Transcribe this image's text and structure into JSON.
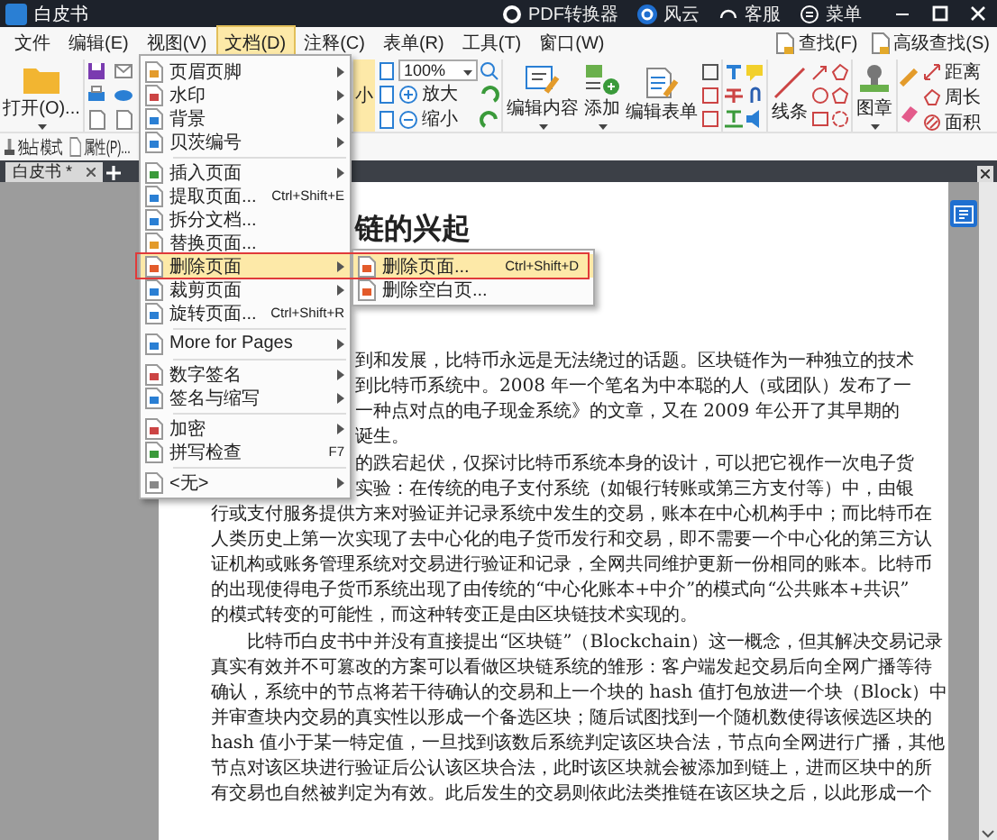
{
  "window": {
    "title": "白皮书"
  },
  "title_bar": [
    {
      "label": "PDF转换器"
    },
    {
      "label": "风云"
    },
    {
      "label": "客服"
    },
    {
      "label": "菜单"
    }
  ],
  "menu_bar": [
    {
      "label": "文件",
      "selected": false
    },
    {
      "label": "编辑(E)",
      "selected": false
    },
    {
      "label": "视图(V)",
      "selected": false
    },
    {
      "label": "文档(D)",
      "selected": true
    },
    {
      "label": "注释(C)",
      "selected": false
    },
    {
      "label": "表单(R)",
      "selected": false
    },
    {
      "label": "工具(T)",
      "selected": false
    },
    {
      "label": "窗口(W)",
      "selected": false
    }
  ],
  "search_buttons": [
    "查找(F)",
    "高级查找(S)"
  ],
  "ribbon": {
    "open": "打开(O)...",
    "partial_label": "小",
    "zoom": "100%",
    "zoom_in": "放大",
    "zoom_out": "缩小",
    "edit_content": "编辑内容",
    "add": "添加",
    "edit_form": "编辑表单",
    "line": "线条",
    "stamp": "图章",
    "distance": "距离",
    "perimeter": "周长",
    "area": "面积",
    "exclusive_mode": "独占模式",
    "properties": "属性(P)..."
  },
  "tabs": [
    {
      "label": "白皮书 *",
      "selected": true
    }
  ],
  "document_menu": [
    {
      "kind": "item",
      "label": "页眉页脚",
      "submenu": true,
      "selected": false
    },
    {
      "kind": "item",
      "label": "水印",
      "submenu": true,
      "selected": false
    },
    {
      "kind": "item",
      "label": "背景",
      "submenu": true,
      "selected": false
    },
    {
      "kind": "item",
      "label": "贝茨编号",
      "submenu": true,
      "selected": false
    },
    {
      "kind": "separator"
    },
    {
      "kind": "item",
      "label": "插入页面",
      "submenu": true,
      "selected": false
    },
    {
      "kind": "item",
      "label": "提取页面...",
      "shortcut": "Ctrl+Shift+E",
      "submenu": false,
      "selected": false
    },
    {
      "kind": "item",
      "label": "拆分文档...",
      "submenu": false,
      "selected": false
    },
    {
      "kind": "item",
      "label": "替换页面...",
      "submenu": false,
      "selected": false
    },
    {
      "kind": "item",
      "label": "删除页面",
      "submenu": true,
      "selected": true
    },
    {
      "kind": "item",
      "label": "裁剪页面",
      "submenu": true,
      "selected": false
    },
    {
      "kind": "item",
      "label": "旋转页面...",
      "shortcut": "Ctrl+Shift+R",
      "submenu": false,
      "selected": false
    },
    {
      "kind": "separator"
    },
    {
      "kind": "item",
      "label": "More for Pages",
      "submenu": true,
      "selected": false
    },
    {
      "kind": "separator"
    },
    {
      "kind": "item",
      "label": "数字签名",
      "submenu": true,
      "selected": false
    },
    {
      "kind": "item",
      "label": "签名与缩写",
      "submenu": true,
      "selected": false
    },
    {
      "kind": "separator"
    },
    {
      "kind": "item",
      "label": "加密",
      "submenu": true,
      "selected": false
    },
    {
      "kind": "item",
      "label": "拼写检查",
      "shortcut": "F7",
      "submenu": false,
      "selected": false
    },
    {
      "kind": "separator"
    },
    {
      "kind": "item",
      "label": "<无>",
      "submenu": true,
      "selected": false
    }
  ],
  "submenu": [
    {
      "label": "删除页面...",
      "shortcut": "Ctrl+Shift+D",
      "selected": true
    },
    {
      "label": "删除空白页...",
      "selected": false
    }
  ],
  "document": {
    "heading": "链的兴起",
    "paragraphs": [
      {
        "lines": [
          {
            "text": "到和发展，比特币永远是无法绕过的话题。区块链作为一种独立的技术",
            "cut": true
          },
          {
            "text": "到比特币系统中。2008 年一个笔名为中本聪的人（或团队）发布了一",
            "cut": true
          },
          {
            "text": "一种点对点的电子现金系统》的文章，又在 2009 年公开了其早期的",
            "cut": true
          },
          {
            "text": "诞生。",
            "cut": true
          }
        ]
      },
      {
        "lines": [
          {
            "text": "的跌宕起伏，仅探讨比特币系统本身的设计，可以把它视作一次电子货",
            "cut": true
          },
          {
            "text": "实验：在传统的电子支付系统（如银行转账或第三方支付等）中，由银",
            "cut": true
          },
          {
            "text": "行或支付服务提供方来对验证并记录系统中发生的交易，账本在中心机构手中；而比特币在",
            "cut": false
          },
          {
            "text": "人类历史上第一次实现了去中心化的电子货币发行和交易，即不需要一个中心化的第三方认",
            "cut": false
          },
          {
            "text": "证机构或账务管理系统对交易进行验证和记录，全网共同维护更新一份相同的账本。比特币",
            "cut": false
          },
          {
            "text": "的出现使得电子货币系统出现了由传统的“中心化账本+中介”的模式向“公共账本+共识”",
            "cut": false
          },
          {
            "text": "的模式转变的可能性，而这种转变正是由区块链技术实现的。",
            "cut": false
          }
        ]
      },
      {
        "lines": [
          {
            "text": "比特币白皮书中并没有直接提出“区块链”（Blockchain）这一概念，但其解决交易记录",
            "cut": false
          },
          {
            "text": "真实有效并不可篡改的方案可以看做区块链系统的雏形：客户端发起交易后向全网广播等待",
            "cut": false
          },
          {
            "text": "确认，系统中的节点将若干待确认的交易和上一个块的 hash 值打包放进一个块（Block）中",
            "cut": false
          },
          {
            "text": "并审查块内交易的真实性以形成一个备选区块；随后试图找到一个随机数使得该候选区块的",
            "cut": false
          },
          {
            "text": "hash 值小于某一特定值，一旦找到该数后系统判定该区块合法，节点向全网进行广播，其他",
            "cut": false
          },
          {
            "text": "节点对该区块进行验证后公认该区块合法，此时该区块就会被添加到链上，进而区块中的所",
            "cut": false
          },
          {
            "text": "有交易也自然被判定为有效。此后发生的交易则依此法类推链在该区块之后，以此形成一个",
            "cut": false
          }
        ]
      }
    ]
  }
}
